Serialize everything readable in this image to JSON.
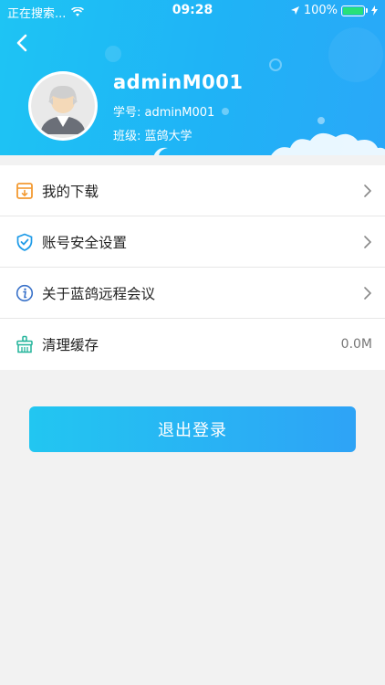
{
  "status_bar": {
    "carrier": "正在搜索...",
    "time": "09:28",
    "battery": "100%"
  },
  "profile": {
    "username": "adminM001",
    "student_id": "学号: adminM001",
    "class_name": "班级: 蓝鸽大学"
  },
  "menu": {
    "items": [
      {
        "label": "我的下载",
        "icon": "download-box-icon"
      },
      {
        "label": "账号安全设置",
        "icon": "shield-check-icon"
      },
      {
        "label": "关于蓝鸽远程会议",
        "icon": "info-icon"
      },
      {
        "label": "清理缓存",
        "icon": "broom-icon",
        "value": "0.0M"
      }
    ]
  },
  "logout_label": "退出登录",
  "colors": {
    "header_start": "#1ec4f4",
    "header_end": "#2aa8f8",
    "button_start": "#22c6f1",
    "button_end": "#2ea3f6",
    "icon_orange": "#f39a32",
    "icon_blue": "#1e9be8",
    "icon_teal": "#22b49a"
  }
}
